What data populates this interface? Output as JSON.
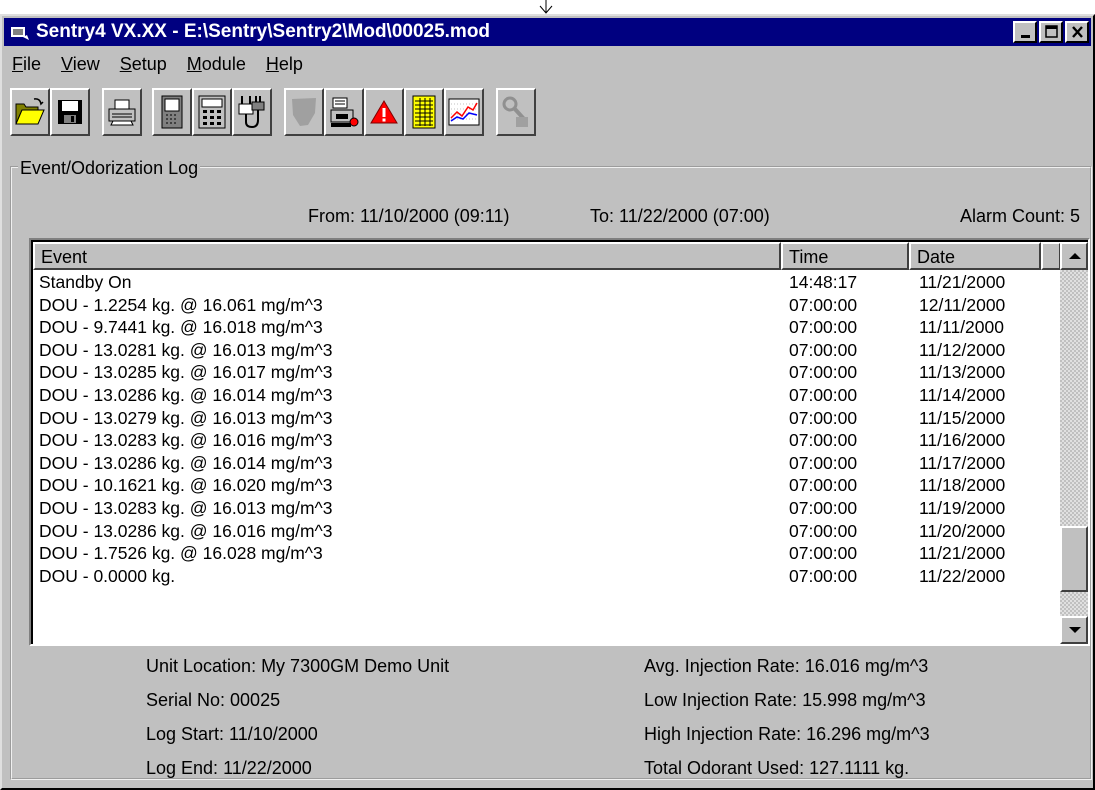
{
  "window": {
    "title": "Sentry4 VX.XX - E:\\Sentry\\Sentry2\\Mod\\00025.mod"
  },
  "menu": [
    {
      "label": "File",
      "accel": "F",
      "rest": "ile"
    },
    {
      "label": "View",
      "accel": "V",
      "rest": "iew"
    },
    {
      "label": "Setup",
      "accel": "S",
      "rest": "etup"
    },
    {
      "label": "Module",
      "accel": "M",
      "rest": "odule"
    },
    {
      "label": "Help",
      "accel": "H",
      "rest": "elp"
    }
  ],
  "toolbar": {
    "buttons": [
      {
        "name": "open-icon"
      },
      {
        "name": "save-icon"
      },
      {
        "name": "print-icon"
      },
      {
        "name": "module-icon"
      },
      {
        "name": "keypad-icon"
      },
      {
        "name": "connect-icon"
      },
      {
        "name": "map-icon"
      },
      {
        "name": "pump-icon"
      },
      {
        "name": "alarm-icon"
      },
      {
        "name": "report-icon"
      },
      {
        "name": "graph-icon"
      },
      {
        "name": "tools-icon"
      }
    ]
  },
  "log": {
    "group_title": "Event/Odorization Log",
    "from": "From: 11/10/2000 (09:11)",
    "to": "To: 11/22/2000 (07:00)",
    "alarm_count": "Alarm Count: 5",
    "columns": {
      "event": "Event",
      "time": "Time",
      "date": "Date"
    },
    "rows": [
      {
        "event": "Standby On",
        "time": "14:48:17",
        "date": "11/21/2000"
      },
      {
        "event": "DOU  -  1.2254 kg. @ 16.061 mg/m^3",
        "time": "07:00:00",
        "date": "12/11/2000"
      },
      {
        "event": "DOU  -  9.7441 kg. @ 16.018 mg/m^3",
        "time": "07:00:00",
        "date": "11/11/2000"
      },
      {
        "event": "DOU  -  13.0281 kg. @ 16.013 mg/m^3",
        "time": "07:00:00",
        "date": "11/12/2000"
      },
      {
        "event": "DOU  -  13.0285 kg. @ 16.017 mg/m^3",
        "time": "07:00:00",
        "date": "11/13/2000"
      },
      {
        "event": "DOU  -  13.0286 kg. @ 16.014 mg/m^3",
        "time": "07:00:00",
        "date": "11/14/2000"
      },
      {
        "event": "DOU  -  13.0279 kg. @ 16.013 mg/m^3",
        "time": "07:00:00",
        "date": "11/15/2000"
      },
      {
        "event": "DOU  -  13.0283 kg. @ 16.016 mg/m^3",
        "time": "07:00:00",
        "date": "11/16/2000"
      },
      {
        "event": "DOU  -  13.0286 kg. @ 16.014 mg/m^3",
        "time": "07:00:00",
        "date": "11/17/2000"
      },
      {
        "event": "DOU  -  10.1621 kg. @ 16.020 mg/m^3",
        "time": "07:00:00",
        "date": "11/18/2000"
      },
      {
        "event": "DOU  -  13.0283 kg. @ 16.013 mg/m^3",
        "time": "07:00:00",
        "date": "11/19/2000"
      },
      {
        "event": "DOU  -  13.0286 kg. @ 16.016 mg/m^3",
        "time": "07:00:00",
        "date": "11/20/2000"
      },
      {
        "event": "DOU  -  1.7526 kg. @ 16.028 mg/m^3",
        "time": "07:00:00",
        "date": "11/21/2000"
      },
      {
        "event": "DOU  -  0.0000 kg.",
        "time": "07:00:00",
        "date": "11/22/2000"
      }
    ]
  },
  "summary": {
    "unit_location": "Unit Location: My 7300GM Demo Unit",
    "serial_no": "Serial No: 00025",
    "log_start": "Log Start: 11/10/2000",
    "log_end": "Log End: 11/22/2000",
    "avg_rate": "Avg. Injection Rate: 16.016 mg/m^3",
    "low_rate": "Low Injection Rate: 15.998 mg/m^3",
    "high_rate": "High Injection Rate: 16.296 mg/m^3",
    "total_used": "Total Odorant Used: 127.1111 kg."
  },
  "colors": {
    "titlebar": "#000080",
    "face": "#c0c0c0",
    "alarm": "#ff0000"
  }
}
